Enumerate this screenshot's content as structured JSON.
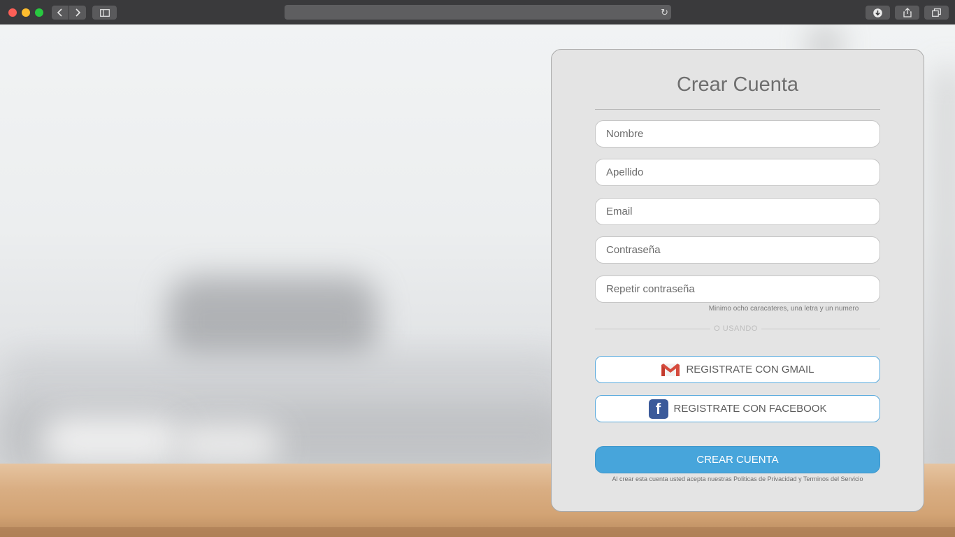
{
  "browser": {
    "icons": {
      "back": "chevron-left-icon",
      "forward": "chevron-right-icon",
      "sidebar": "sidebar-icon",
      "reload": "reload-icon",
      "download": "download-icon",
      "share": "share-icon",
      "tabs": "tabs-icon"
    }
  },
  "form": {
    "title": "Crear Cuenta",
    "fields": {
      "first_name": "Nombre",
      "last_name": "Apellido",
      "email": "Email",
      "password": "Contraseña",
      "password_repeat": "Repetir contraseña"
    },
    "password_hint": "Minimo ocho caracateres, una letra y un numero",
    "or_label": "O USANDO",
    "gmail_label": "REGISTRATE CON  GMAIL",
    "facebook_label": "REGISTRATE CON FACEBOOK",
    "submit_label": "CREAR CUENTA",
    "terms": "Al crear esta cuenta usted acepta nuestras Politicas de Privacidad y Terminos del Servicio"
  },
  "colors": {
    "accent": "#47a5db",
    "panel_bg": "#e4e4e4",
    "facebook": "#3b5a9a",
    "gmail_red": "#d54b3d"
  }
}
